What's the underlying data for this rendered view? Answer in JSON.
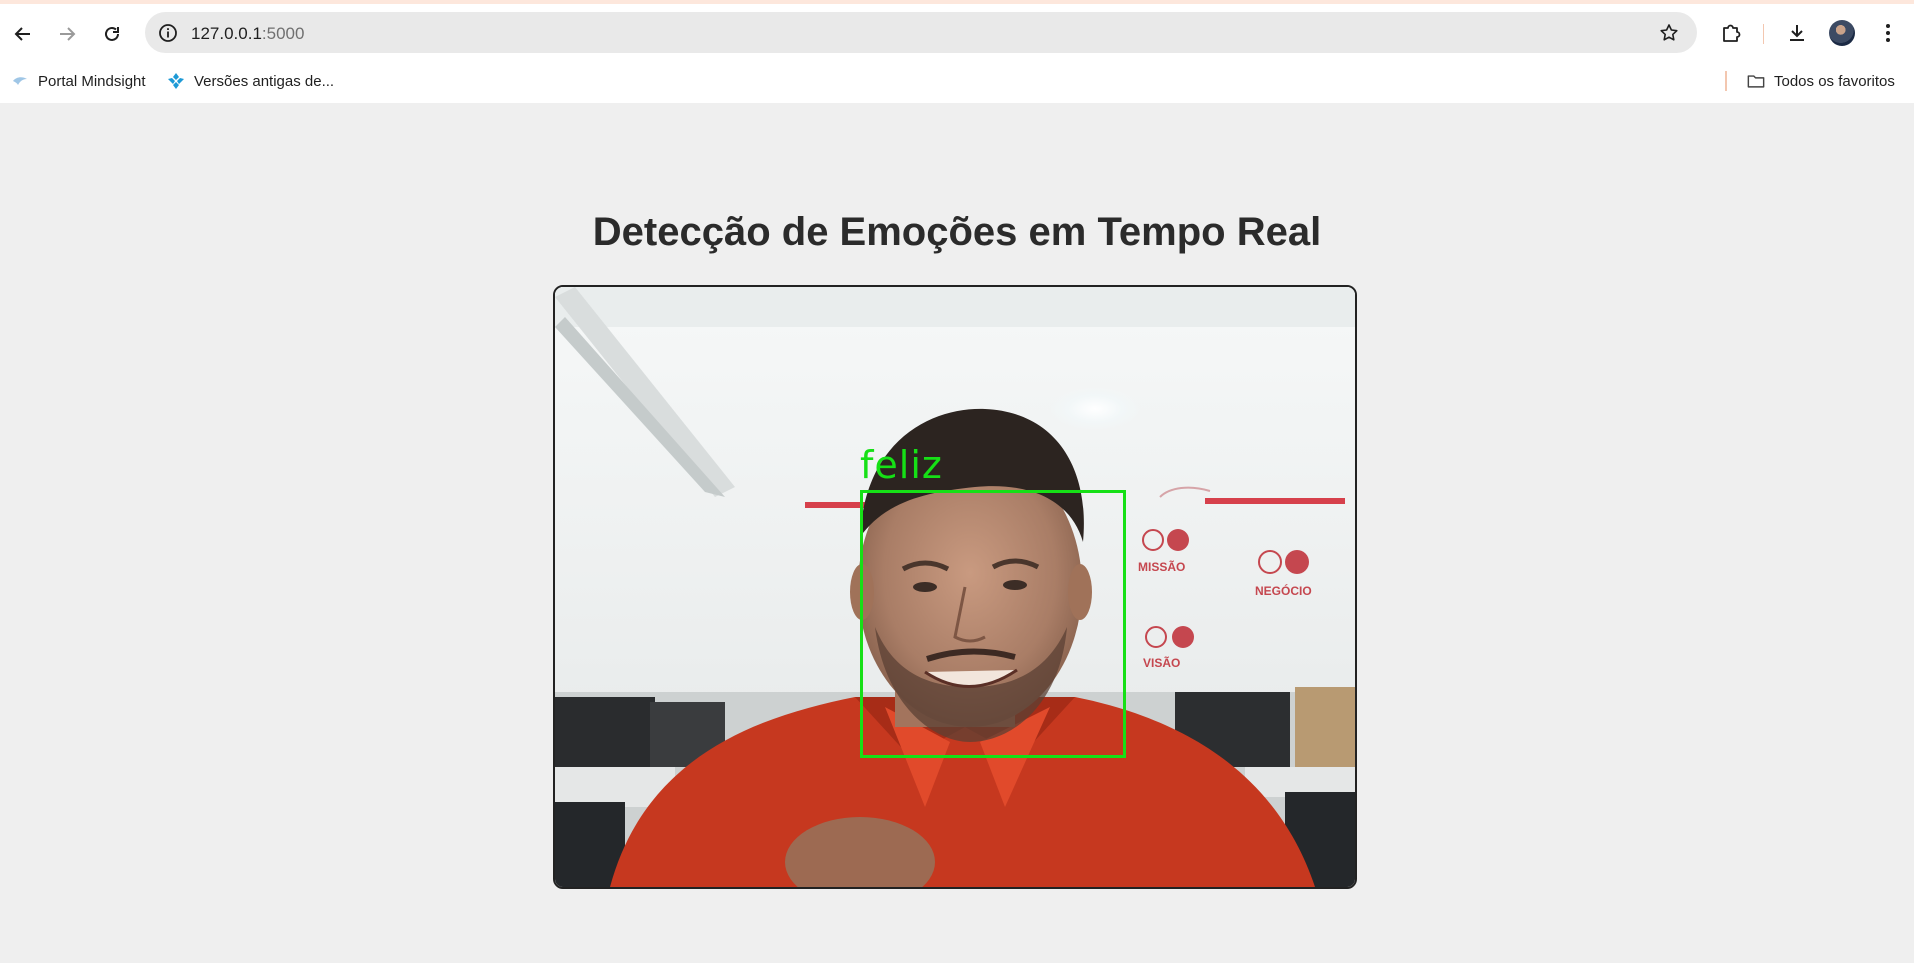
{
  "browser": {
    "url_host": "127.0.0.1",
    "url_port": ":5000",
    "bookmarks": [
      {
        "label": "Portal Mindsight",
        "icon": "mindsight-favicon"
      },
      {
        "label": "Versões antigas de..."
      }
    ],
    "all_bookmarks_label": "Todos os favoritos"
  },
  "page": {
    "title": "Detecção de Emoções em Tempo Real"
  },
  "detection": {
    "emotion_label": "feliz",
    "box_color": "#16e016"
  },
  "background_signs": {
    "missao": "MISSÃO",
    "negocio": "NEGÓCIO",
    "visao": "VISÃO"
  }
}
